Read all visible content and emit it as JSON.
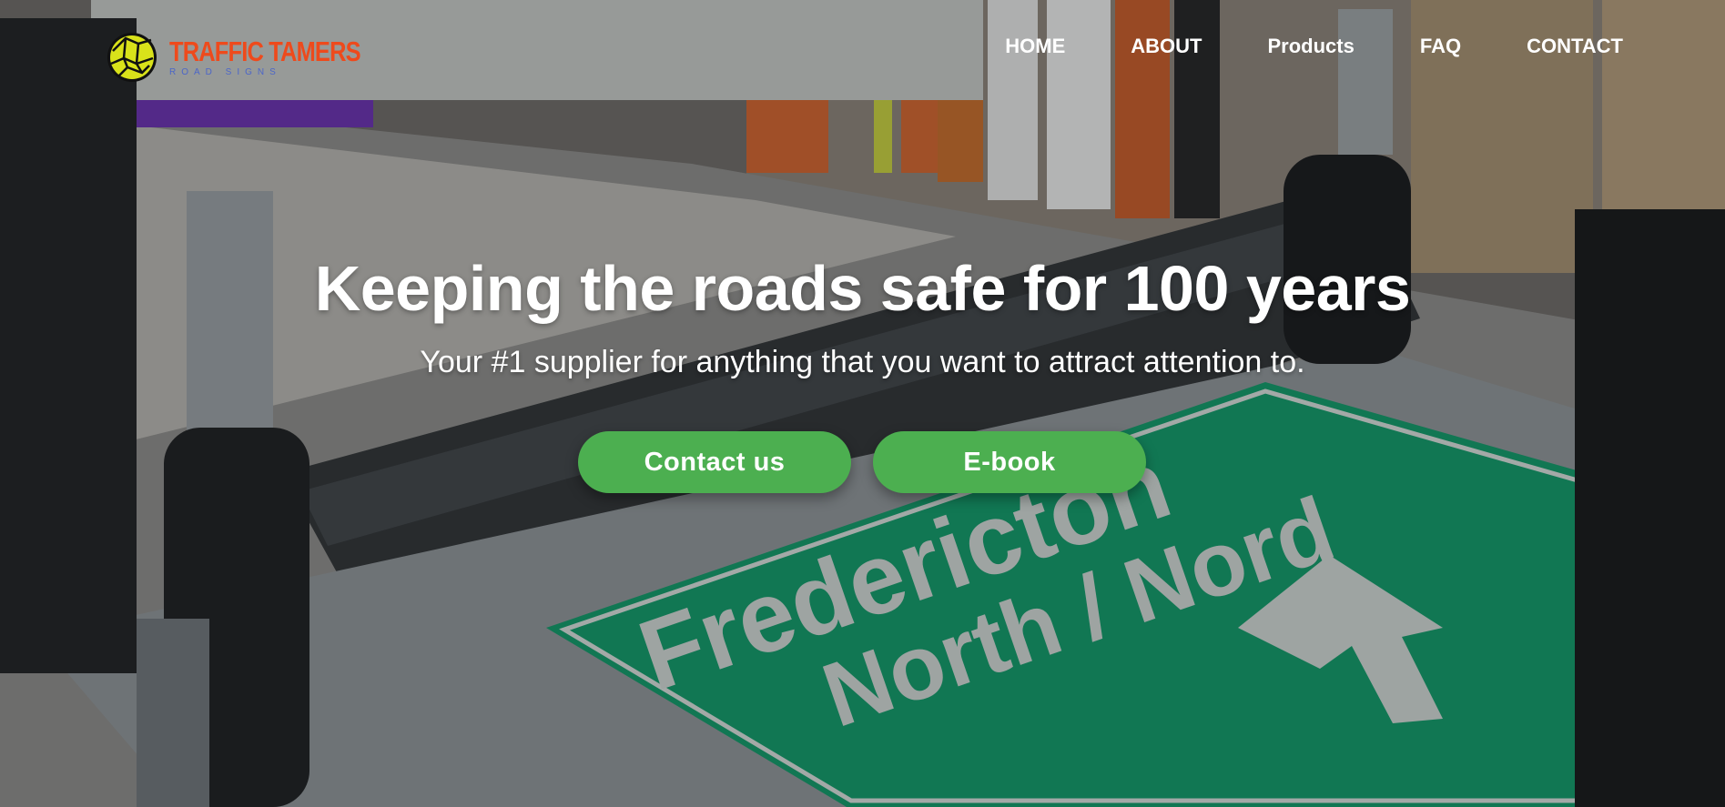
{
  "brand": {
    "name": "TRAFFIC TAMERS",
    "tagline": "ROAD SIGNS",
    "name_color": "#ee4a1c",
    "tagline_color": "#4c66c8",
    "mark_color": "#d9e21a"
  },
  "nav": {
    "items": [
      {
        "label": "HOME"
      },
      {
        "label": "ABOUT"
      },
      {
        "label": "Products"
      },
      {
        "label": "FAQ"
      },
      {
        "label": "CONTACT"
      }
    ]
  },
  "hero": {
    "headline": "Keeping the roads safe for 100 years",
    "subheadline": "Your #1 supplier for anything that you want to attract attention to.",
    "background": {
      "sign_text_line1": "Fredericton",
      "sign_text_line2": "North / Nord",
      "sign_color": "#0f9a67"
    }
  },
  "buttons": {
    "contact": "Contact us",
    "ebook": "E-book",
    "color": "#4caf50"
  }
}
